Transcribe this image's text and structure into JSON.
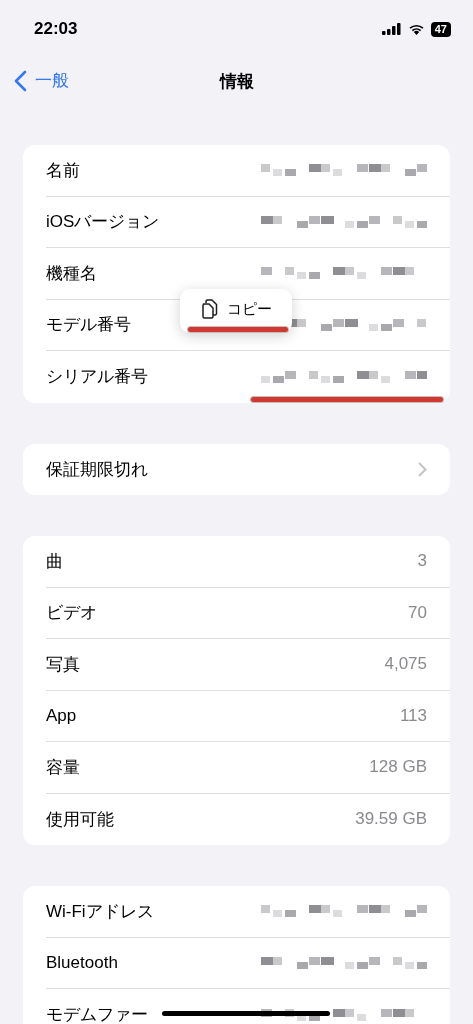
{
  "status_bar": {
    "time": "22:03",
    "battery": "47"
  },
  "nav": {
    "back": "一般",
    "title": "情報"
  },
  "sections": [
    {
      "rows": [
        {
          "label": "名前",
          "kind": "redacted"
        },
        {
          "label": "iOSバージョン",
          "kind": "redacted"
        },
        {
          "label": "機種名",
          "kind": "redacted"
        },
        {
          "label": "モデル番号",
          "kind": "redacted"
        },
        {
          "label": "シリアル番号",
          "kind": "redacted"
        }
      ],
      "popup": {
        "label": "コピー"
      }
    },
    {
      "rows": [
        {
          "label": "保証期限切れ",
          "kind": "link"
        }
      ]
    },
    {
      "rows": [
        {
          "label": "曲",
          "kind": "text",
          "value": "3"
        },
        {
          "label": "ビデオ",
          "kind": "text",
          "value": "70"
        },
        {
          "label": "写真",
          "kind": "text",
          "value": "4,075"
        },
        {
          "label": "App",
          "kind": "text",
          "value": "113"
        },
        {
          "label": "容量",
          "kind": "text",
          "value": "128 GB"
        },
        {
          "label": "使用可能",
          "kind": "text",
          "value": "39.59 GB"
        }
      ]
    },
    {
      "rows": [
        {
          "label": "Wi-Fiアドレス",
          "kind": "redacted"
        },
        {
          "label": "Bluetooth",
          "kind": "redacted"
        },
        {
          "label": "モデムファー",
          "kind": "redacted"
        }
      ]
    }
  ]
}
